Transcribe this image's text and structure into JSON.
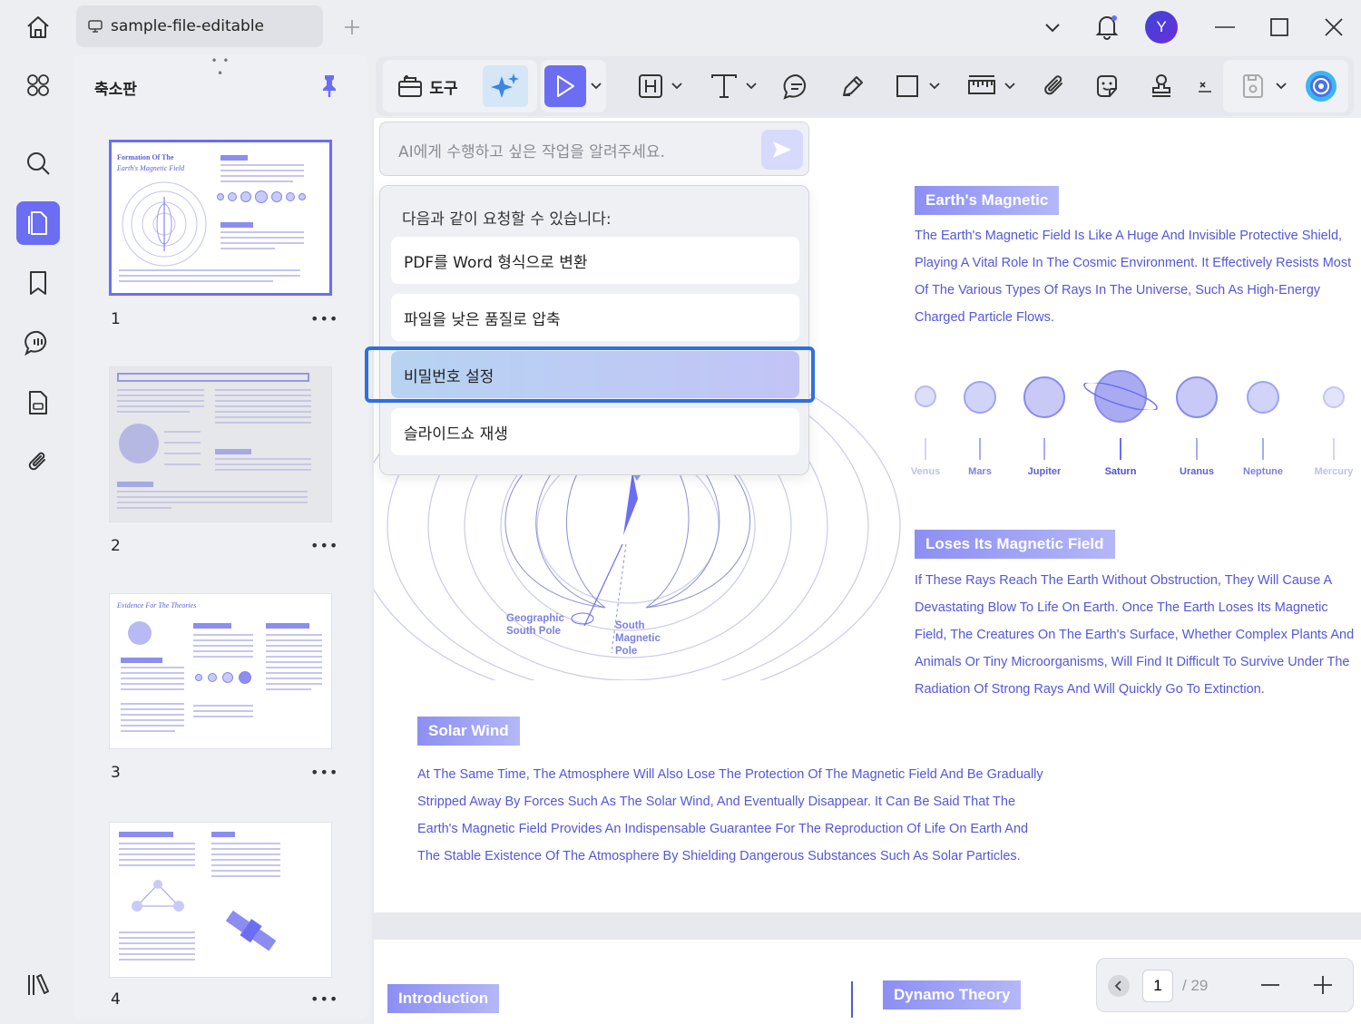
{
  "titlebar": {
    "tab_title": "sample-file-editable",
    "avatar_letter": "Y"
  },
  "thumbnails": {
    "panel_title": "축소판",
    "grip": "• • •",
    "more": "•••",
    "pages": [
      {
        "number": "1",
        "heading": "Formation Of The",
        "subheading": "Earth's Magnetic Field"
      },
      {
        "number": "2"
      },
      {
        "number": "3",
        "heading": "Evidence For The Theories"
      },
      {
        "number": "4"
      }
    ]
  },
  "toolbar": {
    "tools_label": "도구"
  },
  "ai": {
    "placeholder": "AI에게 수행하고 싶은 작업을 알려주세요.",
    "menu_title": "다음과 같이 요청할 수 있습니다:",
    "suggestions": [
      "PDF를 Word 형식으로 변환",
      "파일을 낮은 품질로 압축",
      "비밀번호 설정",
      "슬라이드쇼 재생"
    ]
  },
  "document": {
    "section1": {
      "heading": "Earth's Magnetic",
      "lines": [
        "The Earth's Magnetic Field Is Like A Huge And Invisible Protective Shield,",
        "Playing A Vital Role In The Cosmic Environment. It Effectively Resists Most",
        "Of The Various Types Of Rays In The Universe, Such As High-Energy",
        "Charged Particle Flows."
      ]
    },
    "planets": [
      "Venus",
      "Mars",
      "Jupiter",
      "Saturn",
      "Uranus",
      "Neptune",
      "Mercury"
    ],
    "section2": {
      "heading": "Loses Its Magnetic Field",
      "lines": [
        "If These Rays Reach The Earth Without Obstruction, They Will Cause A",
        "Devastating Blow To Life On Earth. Once The Earth Loses Its Magnetic",
        "Field, The Creatures On The Earth's Surface, Whether Complex Plants And",
        "Animals Or Tiny Microorganisms, Will Find It Difficult To Survive Under The",
        "Radiation Of Strong Rays And Will Quickly Go To Extinction."
      ]
    },
    "diagram": {
      "geo_south_l1": "Geographic",
      "geo_south_l2": "South Pole",
      "mag_south_l1": "South",
      "mag_south_l2": "Magnetic",
      "mag_south_l3": "Pole"
    },
    "section3": {
      "heading": "Solar Wind",
      "lines": [
        "At The Same Time, The Atmosphere Will Also Lose The Protection Of The Magnetic Field And Be Gradually",
        "Stripped Away By Forces Such As The Solar Wind, And Eventually Disappear. It Can Be Said That The",
        "Earth's Magnetic Field Provides An Indispensable Guarantee For The Reproduction Of Life On Earth And",
        "The Stable Existence Of The Atmosphere By Shielding Dangerous Substances Such As Solar Particles."
      ]
    },
    "page2": {
      "heading_left": "Introduction",
      "heading_right": "Dynamo Theory"
    }
  },
  "pagenav": {
    "current": "1",
    "total": "/ 29"
  },
  "colors": {
    "accent": "#6b6ef2",
    "doc_text": "#5457d8",
    "focus": "#2f6fe0"
  }
}
